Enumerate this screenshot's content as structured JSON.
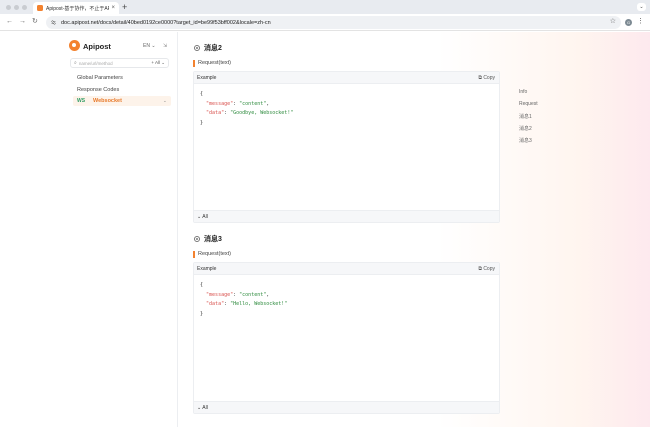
{
  "browser": {
    "tab_title": "Apipost-基于协作，不止于API...",
    "tab_close": "×",
    "new_tab": "+",
    "tab_menu": "⌄",
    "back": "←",
    "forward": "→",
    "reload": "↻",
    "url": "doc.apipost.net/docs/detail/40bed0192ce0000?target_id=be99f53bff002&locale=zh-cn",
    "bookmark": "☆",
    "profile": "G",
    "menu": "⋮"
  },
  "sidebar": {
    "logo": "Apipost",
    "lang": "EN ⌄",
    "collapse": "⇲",
    "search_placeholder": "name/url/method",
    "search_icon": "⌕",
    "search_filter": "+ All ⌄",
    "items": [
      {
        "label": "Global Parameters"
      },
      {
        "label": "Response Codes"
      }
    ],
    "active": {
      "tag": "WS",
      "label": "Websocket",
      "caret": "⌄"
    }
  },
  "messages": [
    {
      "title": "消息2",
      "request": "Request(text)",
      "example": "Example",
      "copy": "⧉ Copy",
      "lines": [
        "{",
        "\"message\": \"content\",",
        "\"data\": \"Goodbye, Websocket!\"",
        "}"
      ],
      "keys": [
        "\"message\"",
        "\"data\""
      ],
      "vals": [
        "\"content\"",
        "\"Goodbye, Websocket!\""
      ],
      "footer": "⌄ All"
    },
    {
      "title": "消息3",
      "request": "Request(text)",
      "example": "Example",
      "copy": "⧉ Copy",
      "keys": [
        "\"message\"",
        "\"data\""
      ],
      "vals": [
        "\"content\"",
        "\"Hello, Websocket!\""
      ],
      "footer": "⌄ All"
    }
  ],
  "toc": [
    "Info",
    "Request",
    "消息1",
    "消息2",
    "消息3"
  ]
}
